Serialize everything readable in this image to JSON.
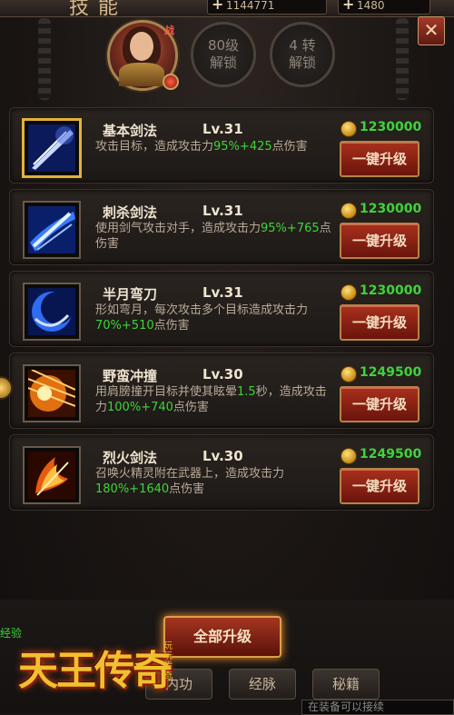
{
  "header": {
    "title": "技能",
    "resources": [
      {
        "icon": "plus-icon",
        "value": "1144771"
      },
      {
        "icon": "plus-icon",
        "value": "1480"
      }
    ],
    "close_label": "✕"
  },
  "avatar": {
    "badge": "战"
  },
  "unlocks": [
    {
      "line1": "80级",
      "line2": "解锁"
    },
    {
      "line1": "4 转",
      "line2": "解锁"
    }
  ],
  "skills": [
    {
      "name": "基本剑法",
      "level": "Lv.31",
      "desc_a": "攻击目标，造成攻击力",
      "pct": "95%",
      "bonus": "+425",
      "desc_b": "点伤害",
      "cost": "1230000",
      "button": "一键升级",
      "icon": "sword-slash-icon"
    },
    {
      "name": "刺杀剑法",
      "level": "Lv.31",
      "desc_a": "使用剑气攻击对手，造成攻击力",
      "pct": "95%",
      "bonus": "+765",
      "desc_b": "点伤害",
      "cost": "1230000",
      "button": "一键升级",
      "icon": "sword-thrust-icon"
    },
    {
      "name": "半月弯刀",
      "level": "Lv.31",
      "desc_a": "形如弯月，每次攻击多个目标造成攻击力",
      "pct": "70%",
      "bonus": "+510",
      "desc_b": "点伤害",
      "cost": "1230000",
      "button": "一键升级",
      "icon": "crescent-blade-icon"
    },
    {
      "name": "野蛮冲撞",
      "level": "Lv.30",
      "desc_a": "用肩膀撞开目标并使其眩晕",
      "stun": "1.5",
      "desc_m": "秒，造成攻击力",
      "pct": "100%",
      "bonus": "+740",
      "desc_b": "点伤害",
      "cost": "1249500",
      "button": "一键升级",
      "icon": "charge-icon"
    },
    {
      "name": "烈火剑法",
      "level": "Lv.30",
      "desc_a": "召唤火精灵附在武器上，造成攻击力",
      "pct": "180%",
      "bonus": "+1640",
      "desc_b": "点伤害",
      "cost": "1249500",
      "button": "一键升级",
      "icon": "flame-sword-icon"
    }
  ],
  "footer": {
    "all_upgrade": "全部升级",
    "exp_label": "经验",
    "tabs": [
      "内功",
      "经脉",
      "秘籍"
    ],
    "logo_text": "天王传奇",
    "logo_sub": "玩玩传奇",
    "hint": "在装备可以接续"
  }
}
